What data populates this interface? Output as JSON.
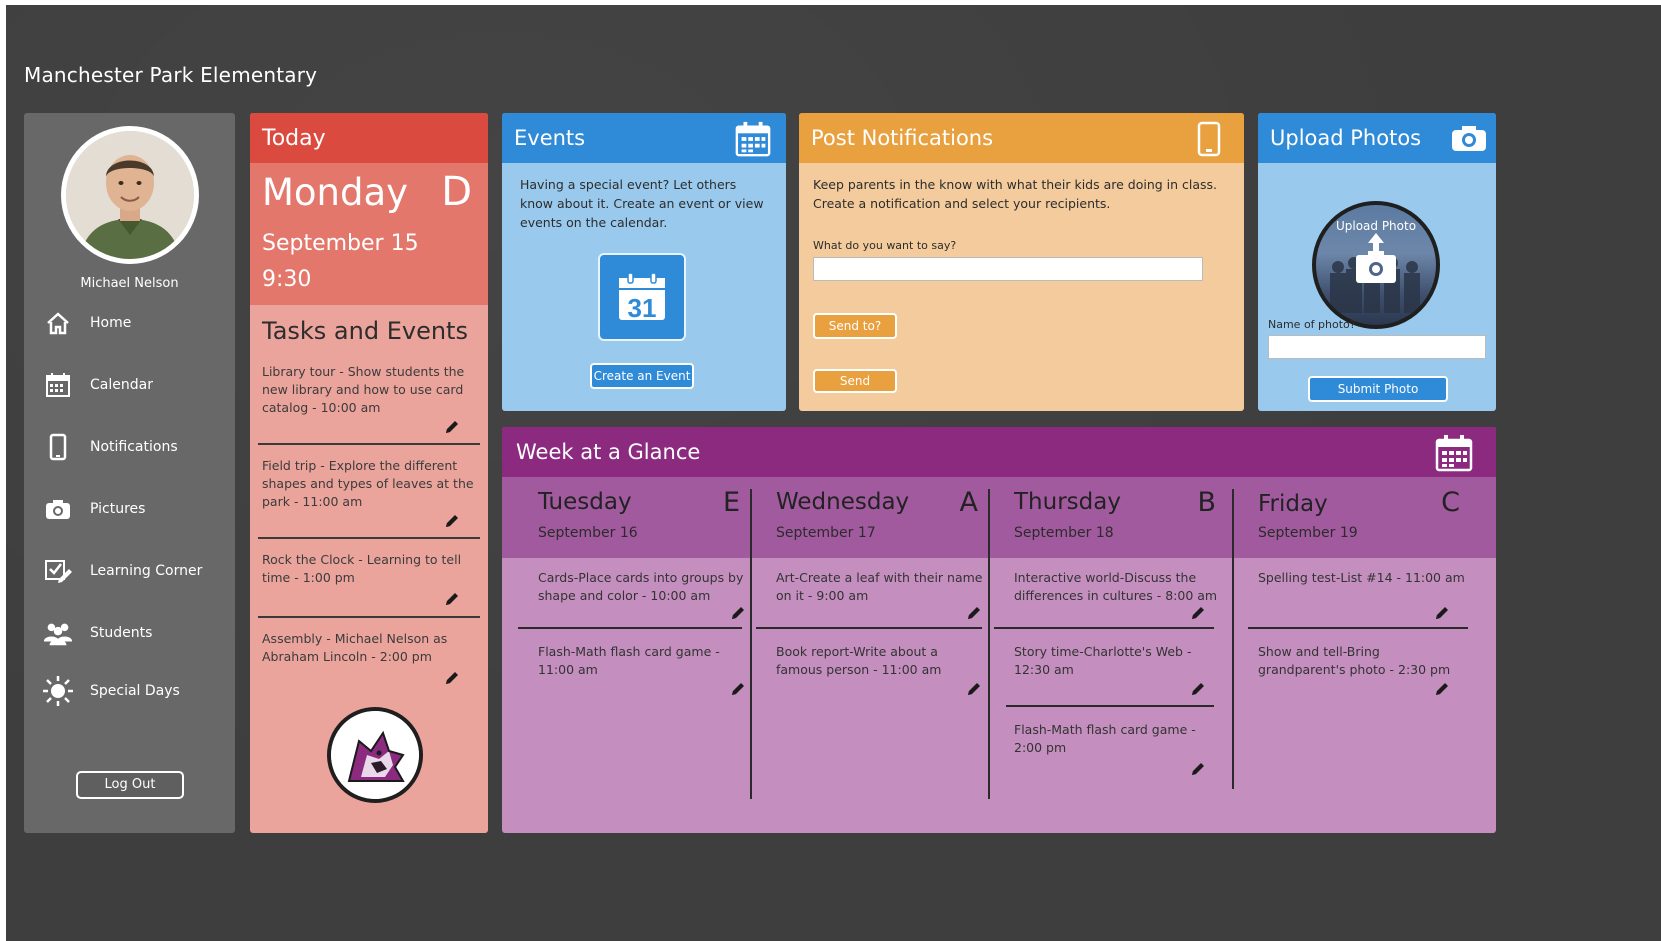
{
  "app": {
    "title": "Manchester Park Elementary"
  },
  "user": {
    "name": "Michael Nelson"
  },
  "nav": [
    {
      "label": "Home",
      "icon": "home-icon"
    },
    {
      "label": "Calendar",
      "icon": "calendar-icon"
    },
    {
      "label": "Notifications",
      "icon": "phone-icon"
    },
    {
      "label": "Pictures",
      "icon": "camera-icon"
    },
    {
      "label": "Learning Corner",
      "icon": "pencil-check-icon"
    },
    {
      "label": "Students",
      "icon": "students-icon"
    },
    {
      "label": "Special Days",
      "icon": "sun-icon"
    }
  ],
  "logout_label": "Log Out",
  "today": {
    "heading": "Today",
    "day": "Monday",
    "letter": "D",
    "date": "September 15",
    "time": "9:30",
    "tasks_title": "Tasks and Events",
    "tasks": [
      "Library tour - Show students the new library and how to use card catalog - 10:00 am",
      "Field trip - Explore the different shapes and types of leaves at the park - 11:00 am",
      "Rock the Clock - Learning to tell time - 1:00 pm",
      "Assembly - Michael Nelson as Abraham Lincoln - 2:00 pm"
    ]
  },
  "events": {
    "heading": "Events",
    "text": "Having a special event? Let others know about it.  Create an event or view events on the calendar.",
    "calendar_day": "31",
    "create_label": "Create an Event"
  },
  "notifications": {
    "heading": "Post Notifications",
    "text": "Keep parents in the know with what their kids are doing in class.  Create a notification and select your recipients.",
    "prompt_label": "What do you want to say?",
    "message_value": "",
    "send_to_label": "Send to?",
    "send_label": "Send"
  },
  "upload": {
    "heading": "Upload Photos",
    "photo_label": "Upload Photo",
    "name_label": "Name of photo?",
    "name_value": "",
    "submit_label": "Submit Photo"
  },
  "week": {
    "heading": "Week at a Glance",
    "days": [
      {
        "name": "Tuesday",
        "letter": "E",
        "date": "September 16",
        "tasks": [
          "Cards-Place cards into groups by shape and color  -  10:00 am",
          "Flash-Math flash card game  -  11:00 am"
        ]
      },
      {
        "name": "Wednesday",
        "letter": "A",
        "date": "September 17",
        "tasks": [
          "Art-Create a leaf with their name on it  -  9:00 am",
          "Book report-Write about a famous person  - 11:00 am"
        ]
      },
      {
        "name": "Thursday",
        "letter": "B",
        "date": "September 18",
        "tasks": [
          "Interactive world-Discuss the differences in cultures  -  8:00 am",
          "Story time-Charlotte's Web  -  12:30 am",
          "Flash-Math flash card game  -  2:00 pm"
        ]
      },
      {
        "name": "Friday",
        "letter": "C",
        "date": "September 19",
        "tasks": [
          "Spelling test-List #14  -  11:00 am",
          "Show and tell-Bring grandparent's photo  -  2:30 pm"
        ]
      }
    ]
  }
}
